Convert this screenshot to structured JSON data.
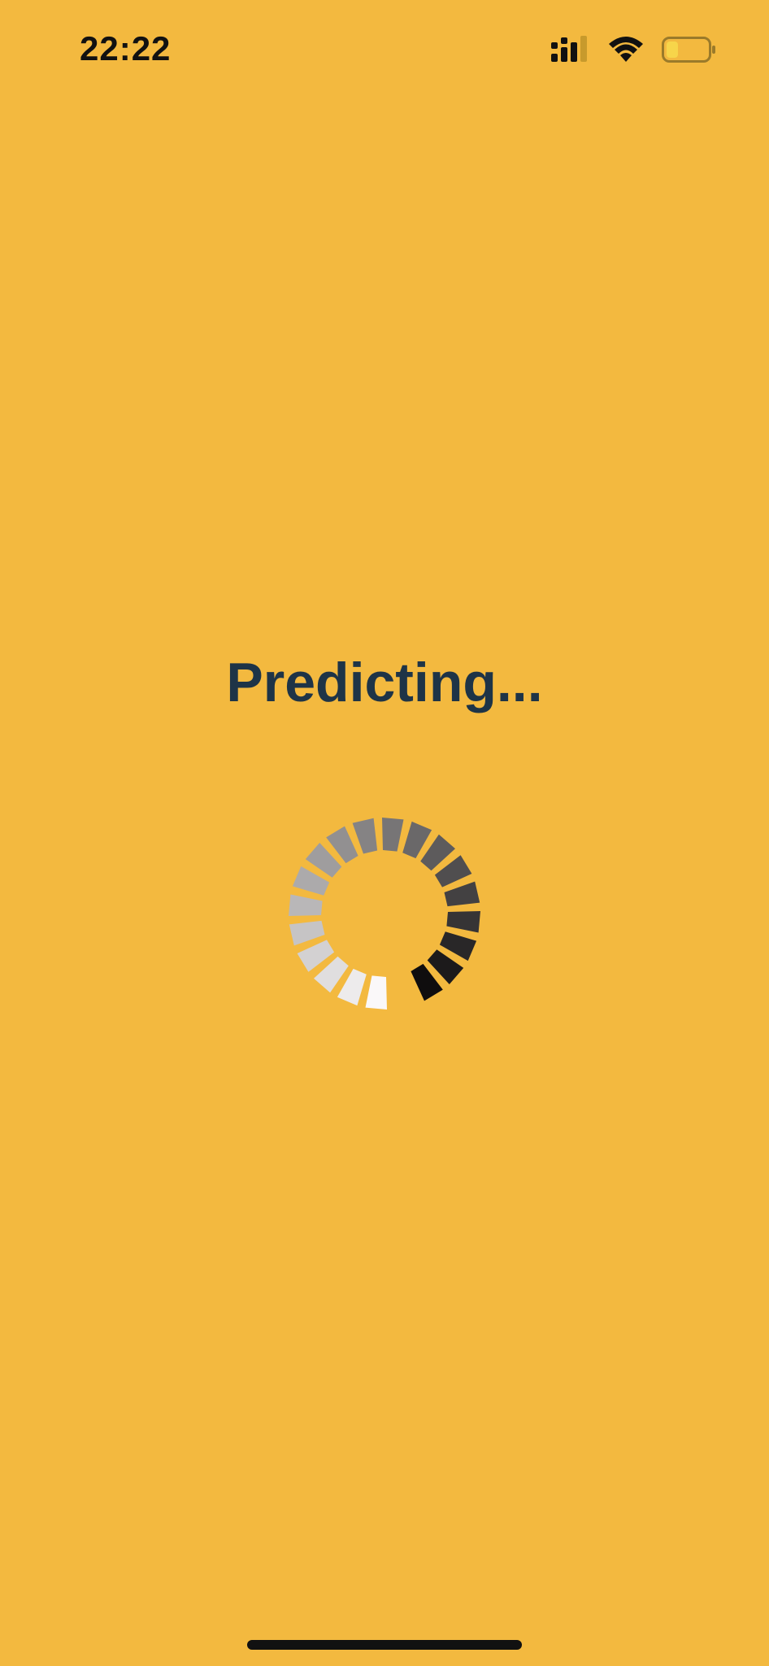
{
  "status_bar": {
    "time": "22:22",
    "signal_icon": "cellular-signal-icon",
    "wifi_icon": "wifi-icon",
    "battery_icon": "battery-low-icon"
  },
  "main": {
    "title": "Predicting..."
  },
  "spinner": {
    "icon": "activity-spinner-icon",
    "segment_count": 20
  },
  "colors": {
    "background": "#F3B93F",
    "title": "#1E3447",
    "battery_fill": "#F7D54A"
  }
}
